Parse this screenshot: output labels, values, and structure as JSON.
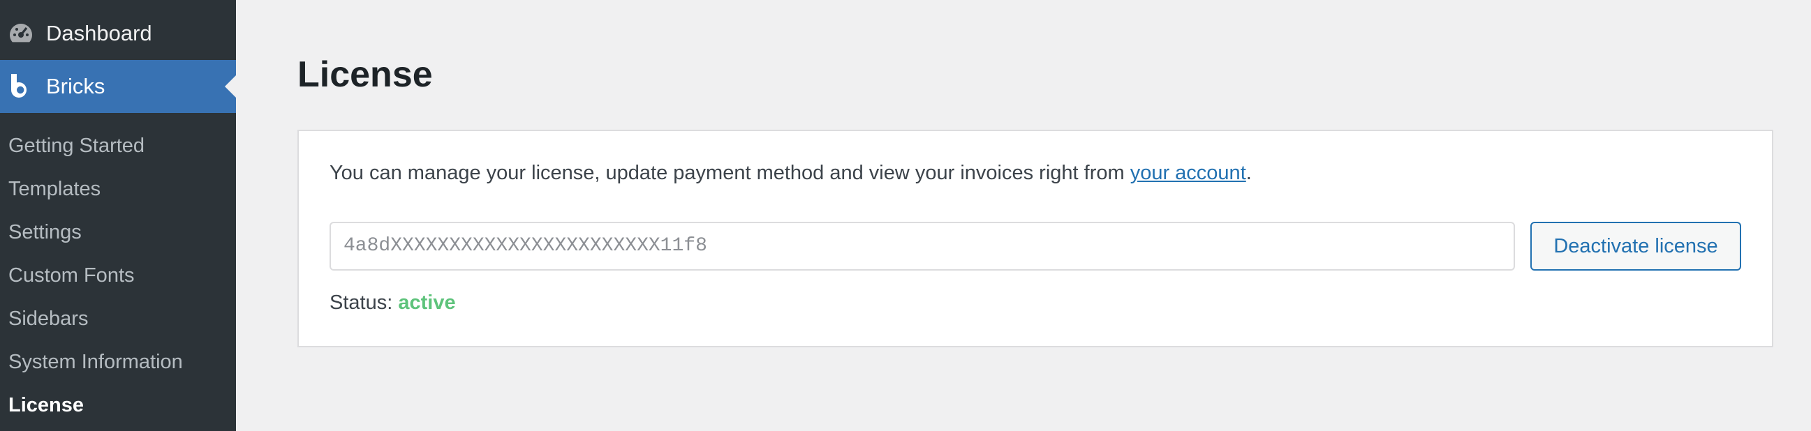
{
  "sidebar": {
    "dashboard": {
      "label": "Dashboard",
      "icon": "dashboard-gauge-icon"
    },
    "bricks": {
      "label": "Bricks",
      "icon": "bricks-b-icon"
    },
    "items": [
      {
        "label": "Getting Started"
      },
      {
        "label": "Templates"
      },
      {
        "label": "Settings"
      },
      {
        "label": "Custom Fonts"
      },
      {
        "label": "Sidebars"
      },
      {
        "label": "System Information"
      },
      {
        "label": "License"
      }
    ],
    "current": "License",
    "colors": {
      "background": "#2c3338",
      "active": "#3872b3"
    }
  },
  "main": {
    "title": "License",
    "description_prefix": "You can manage your license, update payment method and view your invoices right from ",
    "account_link": "your account",
    "description_suffix": ".",
    "license_key_value": "4a8dXXXXXXXXXXXXXXXXXXXXXXX11f8",
    "deactivate_label": "Deactivate license",
    "status_label": "Status:",
    "status_value": "active",
    "colors": {
      "link": "#2271b1",
      "status_active": "#5ec37b"
    }
  }
}
